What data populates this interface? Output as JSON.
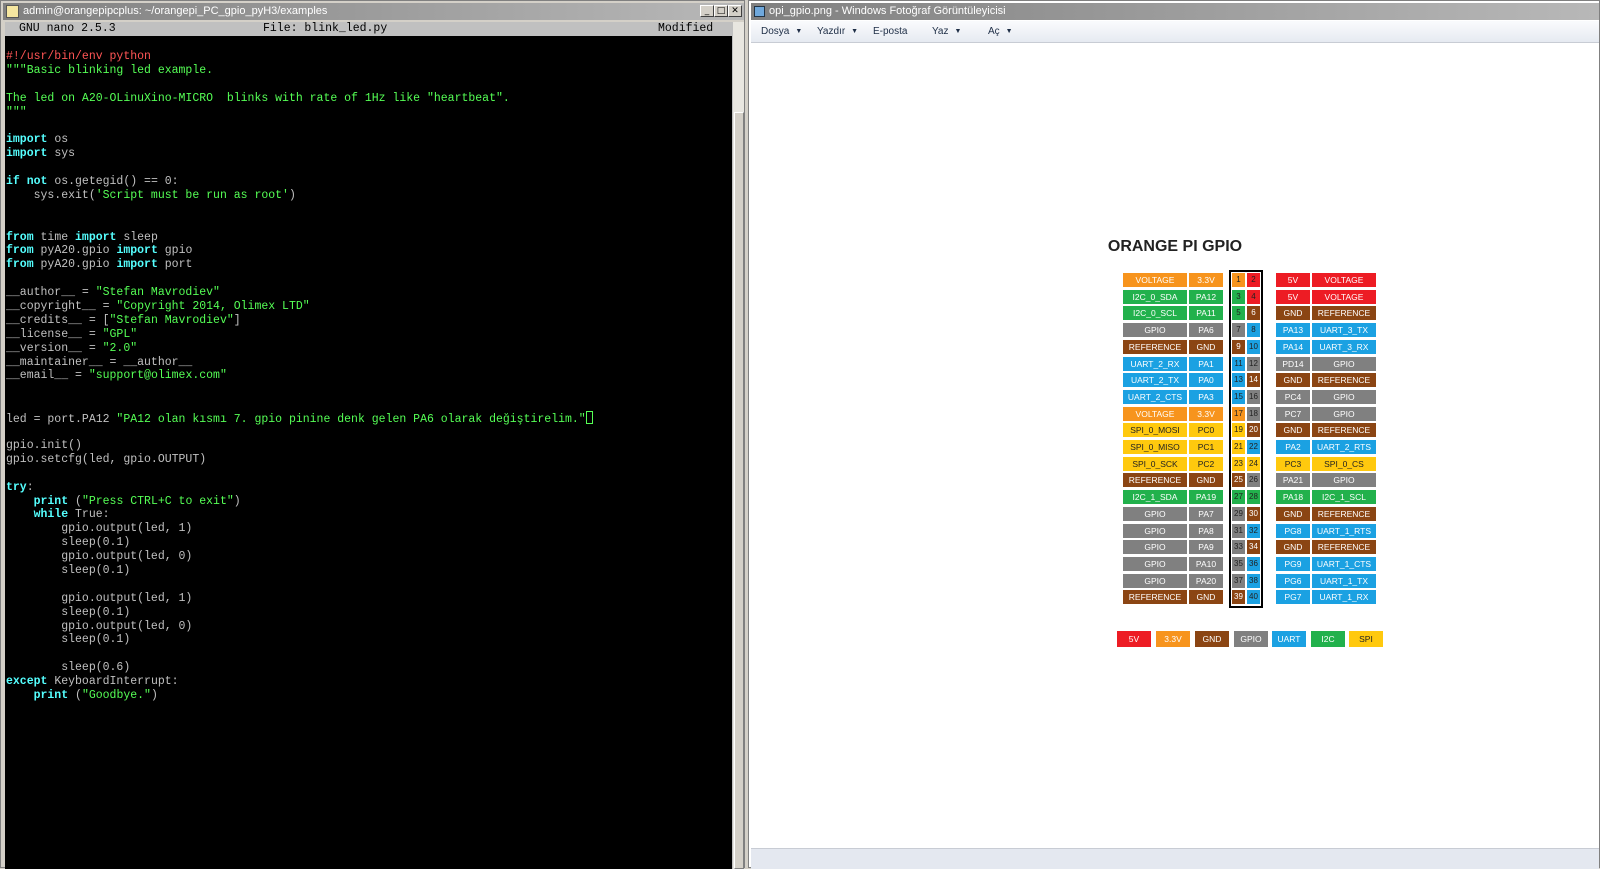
{
  "terminal": {
    "title": "admin@orangepipcplus: ~/orangepi_PC_gpio_pyH3/examples",
    "nano_version": "GNU nano 2.5.3",
    "file_label": "File: blink_led.py",
    "status": "Modified",
    "lines": [
      [
        {
          "c": "red",
          "t": "#!/usr/bin/env python"
        }
      ],
      [
        {
          "c": "green",
          "t": "\"\"\"Basic blinking led example."
        }
      ],
      [
        {
          "c": "green",
          "t": ""
        }
      ],
      [
        {
          "c": "green",
          "t": "The led on A20-OLinuXino-MICRO  blinks with rate of 1Hz like \"heartbeat\"."
        }
      ],
      [
        {
          "c": "green",
          "t": "\"\"\""
        }
      ],
      [
        {
          "c": "white",
          "t": ""
        }
      ],
      [
        {
          "c": "cyan",
          "t": "import"
        },
        {
          "c": "white",
          "t": " os"
        }
      ],
      [
        {
          "c": "cyan",
          "t": "import"
        },
        {
          "c": "white",
          "t": " sys"
        }
      ],
      [
        {
          "c": "white",
          "t": ""
        }
      ],
      [
        {
          "c": "cyan",
          "t": "if not"
        },
        {
          "c": "white",
          "t": " os.getegid() == 0:"
        }
      ],
      [
        {
          "c": "white",
          "t": "    sys.exit("
        },
        {
          "c": "green",
          "t": "'Script must be run as root'"
        },
        {
          "c": "white",
          "t": ")"
        }
      ],
      [
        {
          "c": "white",
          "t": ""
        }
      ],
      [
        {
          "c": "white",
          "t": ""
        }
      ],
      [
        {
          "c": "cyan",
          "t": "from"
        },
        {
          "c": "white",
          "t": " time "
        },
        {
          "c": "cyan",
          "t": "import"
        },
        {
          "c": "white",
          "t": " sleep"
        }
      ],
      [
        {
          "c": "cyan",
          "t": "from"
        },
        {
          "c": "white",
          "t": " pyA20.gpio "
        },
        {
          "c": "cyan",
          "t": "import"
        },
        {
          "c": "white",
          "t": " gpio"
        }
      ],
      [
        {
          "c": "cyan",
          "t": "from"
        },
        {
          "c": "white",
          "t": " pyA20.gpio "
        },
        {
          "c": "cyan",
          "t": "import"
        },
        {
          "c": "white",
          "t": " port"
        }
      ],
      [
        {
          "c": "white",
          "t": ""
        }
      ],
      [
        {
          "c": "white",
          "t": "__author__ = "
        },
        {
          "c": "green",
          "t": "\"Stefan Mavrodiev\""
        }
      ],
      [
        {
          "c": "white",
          "t": "__copyright__ = "
        },
        {
          "c": "green",
          "t": "\"Copyright 2014, Olimex LTD\""
        }
      ],
      [
        {
          "c": "white",
          "t": "__credits__ = ["
        },
        {
          "c": "green",
          "t": "\"Stefan Mavrodiev\""
        },
        {
          "c": "white",
          "t": "]"
        }
      ],
      [
        {
          "c": "white",
          "t": "__license__ = "
        },
        {
          "c": "green",
          "t": "\"GPL\""
        }
      ],
      [
        {
          "c": "white",
          "t": "__version__ = "
        },
        {
          "c": "green",
          "t": "\"2.0\""
        }
      ],
      [
        {
          "c": "white",
          "t": "__maintainer__ = __author__"
        }
      ],
      [
        {
          "c": "white",
          "t": "__email__ = "
        },
        {
          "c": "green",
          "t": "\"support@olimex.com\""
        }
      ],
      [
        {
          "c": "white",
          "t": ""
        }
      ],
      [
        {
          "c": "white",
          "t": ""
        }
      ],
      [
        {
          "c": "white",
          "t": "led = port.PA12 "
        },
        {
          "c": "green",
          "t": "\"PA12 olan kısmı 7. gpio pinine denk gelen PA6 olarak değiştirelim.\""
        }
      ],
      [
        {
          "c": "white",
          "t": ""
        }
      ],
      [
        {
          "c": "white",
          "t": "gpio.init()"
        }
      ],
      [
        {
          "c": "white",
          "t": "gpio.setcfg(led, gpio.OUTPUT)"
        }
      ],
      [
        {
          "c": "white",
          "t": ""
        }
      ],
      [
        {
          "c": "cyan",
          "t": "try"
        },
        {
          "c": "white",
          "t": ":"
        }
      ],
      [
        {
          "c": "cyan",
          "t": "    print"
        },
        {
          "c": "white",
          "t": " ("
        },
        {
          "c": "green",
          "t": "\"Press CTRL+C to exit\""
        },
        {
          "c": "white",
          "t": ")"
        }
      ],
      [
        {
          "c": "cyan",
          "t": "    while"
        },
        {
          "c": "white",
          "t": " True:"
        }
      ],
      [
        {
          "c": "white",
          "t": "        gpio.output(led, 1)"
        }
      ],
      [
        {
          "c": "white",
          "t": "        sleep(0.1)"
        }
      ],
      [
        {
          "c": "white",
          "t": "        gpio.output(led, 0)"
        }
      ],
      [
        {
          "c": "white",
          "t": "        sleep(0.1)"
        }
      ],
      [
        {
          "c": "white",
          "t": ""
        }
      ],
      [
        {
          "c": "white",
          "t": "        gpio.output(led, 1)"
        }
      ],
      [
        {
          "c": "white",
          "t": "        sleep(0.1)"
        }
      ],
      [
        {
          "c": "white",
          "t": "        gpio.output(led, 0)"
        }
      ],
      [
        {
          "c": "white",
          "t": "        sleep(0.1)"
        }
      ],
      [
        {
          "c": "white",
          "t": ""
        }
      ],
      [
        {
          "c": "white",
          "t": "        sleep(0.6)"
        }
      ],
      [
        {
          "c": "cyan",
          "t": "except"
        },
        {
          "c": "white",
          "t": " KeyboardInterrupt:"
        }
      ],
      [
        {
          "c": "cyan",
          "t": "    print"
        },
        {
          "c": "white",
          "t": " ("
        },
        {
          "c": "green",
          "t": "\"Goodbye.\""
        },
        {
          "c": "white",
          "t": ")"
        }
      ]
    ]
  },
  "viewer": {
    "title": "opi_gpio.png - Windows Fotoğraf Görüntüleyicisi",
    "menu": [
      "Dosya",
      "Yazdır",
      "E-posta",
      "Yaz",
      "Aç"
    ],
    "gpio": {
      "title": "ORANGE PI GPIO",
      "colors": {
        "5V": "#ed1c24",
        "3.3V": "#f7941d",
        "GND": "#8b4513",
        "GPIO": "#808080",
        "UART": "#1ba1e2",
        "I2C": "#22b14c",
        "SPI": "#ffc90e"
      },
      "rows": [
        {
          "lname": "VOLTAGE",
          "lport": "3.3V",
          "lcol": "3.3V",
          "lpin": "1",
          "rpin": "2",
          "rport": "5V",
          "rname": "VOLTAGE",
          "rcol": "5V"
        },
        {
          "lname": "I2C_0_SDA",
          "lport": "PA12",
          "lcol": "I2C",
          "lpin": "3",
          "rpin": "4",
          "rport": "5V",
          "rname": "VOLTAGE",
          "rcol": "5V"
        },
        {
          "lname": "I2C_0_SCL",
          "lport": "PA11",
          "lcol": "I2C",
          "lpin": "5",
          "rpin": "6",
          "rport": "GND",
          "rname": "REFERENCE",
          "rcol": "GND"
        },
        {
          "lname": "GPIO",
          "lport": "PA6",
          "lcol": "GPIO",
          "lpin": "7",
          "rpin": "8",
          "rport": "PA13",
          "rname": "UART_3_TX",
          "rcol": "UART"
        },
        {
          "lname": "REFERENCE",
          "lport": "GND",
          "lcol": "GND",
          "lpin": "9",
          "rpin": "10",
          "rport": "PA14",
          "rname": "UART_3_RX",
          "rcol": "UART"
        },
        {
          "lname": "UART_2_RX",
          "lport": "PA1",
          "lcol": "UART",
          "lpin": "11",
          "rpin": "12",
          "rport": "PD14",
          "rname": "GPIO",
          "rcol": "GPIO"
        },
        {
          "lname": "UART_2_TX",
          "lport": "PA0",
          "lcol": "UART",
          "lpin": "13",
          "rpin": "14",
          "rport": "GND",
          "rname": "REFERENCE",
          "rcol": "GND"
        },
        {
          "lname": "UART_2_CTS",
          "lport": "PA3",
          "lcol": "UART",
          "lpin": "15",
          "rpin": "16",
          "rport": "PC4",
          "rname": "GPIO",
          "rcol": "GPIO"
        },
        {
          "lname": "VOLTAGE",
          "lport": "3.3V",
          "lcol": "3.3V",
          "lpin": "17",
          "rpin": "18",
          "rport": "PC7",
          "rname": "GPIO",
          "rcol": "GPIO"
        },
        {
          "lname": "SPI_0_MOSI",
          "lport": "PC0",
          "lcol": "SPI",
          "lpin": "19",
          "rpin": "20",
          "rport": "GND",
          "rname": "REFERENCE",
          "rcol": "GND"
        },
        {
          "lname": "SPI_0_MISO",
          "lport": "PC1",
          "lcol": "SPI",
          "lpin": "21",
          "rpin": "22",
          "rport": "PA2",
          "rname": "UART_2_RTS",
          "rcol": "UART"
        },
        {
          "lname": "SPI_0_SCK",
          "lport": "PC2",
          "lcol": "SPI",
          "lpin": "23",
          "rpin": "24",
          "rport": "PC3",
          "rname": "SPI_0_CS",
          "rcol": "SPI"
        },
        {
          "lname": "REFERENCE",
          "lport": "GND",
          "lcol": "GND",
          "lpin": "25",
          "rpin": "26",
          "rport": "PA21",
          "rname": "GPIO",
          "rcol": "GPIO"
        },
        {
          "lname": "I2C_1_SDA",
          "lport": "PA19",
          "lcol": "I2C",
          "lpin": "27",
          "rpin": "28",
          "rport": "PA18",
          "rname": "I2C_1_SCL",
          "rcol": "I2C"
        },
        {
          "lname": "GPIO",
          "lport": "PA7",
          "lcol": "GPIO",
          "lpin": "29",
          "rpin": "30",
          "rport": "GND",
          "rname": "REFERENCE",
          "rcol": "GND"
        },
        {
          "lname": "GPIO",
          "lport": "PA8",
          "lcol": "GPIO",
          "lpin": "31",
          "rpin": "32",
          "rport": "PG8",
          "rname": "UART_1_RTS",
          "rcol": "UART"
        },
        {
          "lname": "GPIO",
          "lport": "PA9",
          "lcol": "GPIO",
          "lpin": "33",
          "rpin": "34",
          "rport": "GND",
          "rname": "REFERENCE",
          "rcol": "GND"
        },
        {
          "lname": "GPIO",
          "lport": "PA10",
          "lcol": "GPIO",
          "lpin": "35",
          "rpin": "36",
          "rport": "PG9",
          "rname": "UART_1_CTS",
          "rcol": "UART"
        },
        {
          "lname": "GPIO",
          "lport": "PA20",
          "lcol": "GPIO",
          "lpin": "37",
          "rpin": "38",
          "rport": "PG6",
          "rname": "UART_1_TX",
          "rcol": "UART"
        },
        {
          "lname": "REFERENCE",
          "lport": "GND",
          "lcol": "GND",
          "lpin": "39",
          "rpin": "40",
          "rport": "PG7",
          "rname": "UART_1_RX",
          "rcol": "UART"
        }
      ],
      "legend": [
        "5V",
        "3.3V",
        "GND",
        "GPIO",
        "UART",
        "I2C",
        "SPI"
      ]
    }
  }
}
